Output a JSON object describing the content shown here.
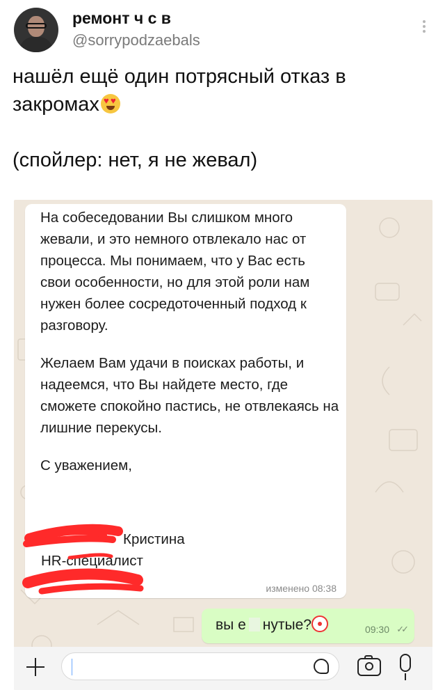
{
  "tweet": {
    "display_name": "ремонт ч с в",
    "handle": "@sorrypodzaebals",
    "text_line1": "нашёл ещё один потрясный отказ в",
    "text_line2": "закромах",
    "text_line3": "(спойлер: нет, я не жевал)"
  },
  "chat": {
    "incoming": {
      "paragraph1": "На собеседовании Вы слишком много жевали, и это немного отвлекало нас от процесса. Мы понимаем, что у Вас есть свои особенности, но для этой роли нам нужен более сосредоточенный подход к разговору.",
      "paragraph2": "Желаем Вам удачи в поисках работы, и надеемся, что Вы найдете место, где сможете спокойно пастись, не отвлекаясь на лишние перекусы.",
      "closing": "С уважением,",
      "signature_name": "Кристина",
      "signature_role": "HR-специалист",
      "time": "изменено 08:38"
    },
    "outgoing": {
      "text_before": "вы е",
      "text_after": "нутые?",
      "time": "09:30"
    }
  },
  "icons": {
    "more": "more-vertical-icon",
    "emoji": "heart-eyes-emoji",
    "clown": "clown-emoji",
    "ticks": "double-check-icon",
    "plus": "plus-icon",
    "sticker": "sticker-icon",
    "camera": "camera-icon",
    "mic": "microphone-icon"
  },
  "colors": {
    "chat_bg": "#efe7dc",
    "outgoing_bubble": "#d9fdc4",
    "scribble": "#ff2a2a"
  }
}
